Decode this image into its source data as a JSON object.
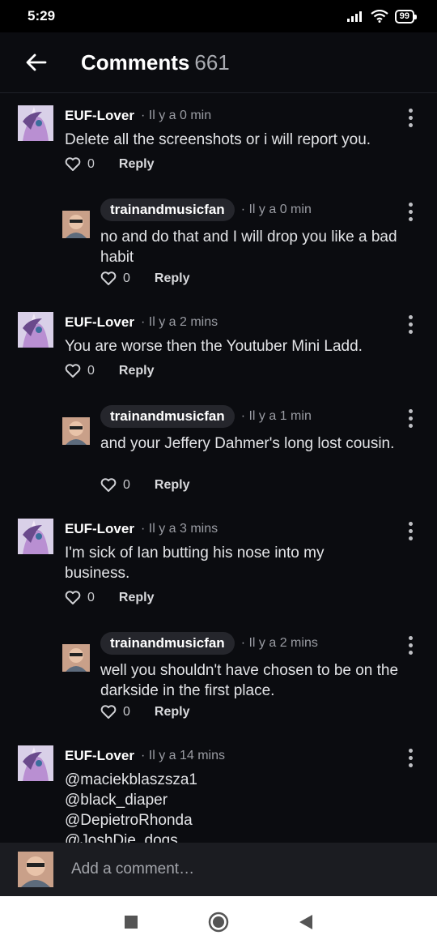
{
  "status": {
    "time": "5:29",
    "battery": "99"
  },
  "header": {
    "title": "Comments",
    "count": "661"
  },
  "comments": [
    {
      "author": "EUF-Lover",
      "meta": "· Il y a 0 min",
      "text": "Delete all the screenshots or i will report you.",
      "likes": "0",
      "reply_label": "Reply",
      "reply_level": false
    },
    {
      "author": "trainandmusicfan",
      "meta": "· Il y a 0 min",
      "text": "no and do that and I will drop you like a bad habit",
      "likes": "0",
      "reply_label": "Reply",
      "reply_level": true
    },
    {
      "author": "EUF-Lover",
      "meta": "· Il y a 2 mins",
      "text": "You are worse then the Youtuber Mini Ladd.",
      "likes": "0",
      "reply_label": "Reply",
      "reply_level": false
    },
    {
      "author": "trainandmusicfan",
      "meta": "· Il y a 1 min",
      "text": "and your Jeffery Dahmer's long lost cousin.",
      "likes": "0",
      "reply_label": "Reply",
      "reply_level": true
    },
    {
      "author": "EUF-Lover",
      "meta": "· Il y a 3 mins",
      "text": "I'm sick of Ian butting his nose into my business.",
      "likes": "0",
      "reply_label": "Reply",
      "reply_level": false
    },
    {
      "author": "trainandmusicfan",
      "meta": "· Il y a 2 mins",
      "text": "well you shouldn't have chosen to be on the darkside in the first place.",
      "likes": "0",
      "reply_label": "Reply",
      "reply_level": true
    },
    {
      "author": "EUF-Lover",
      "meta": "· Il y a 14 mins",
      "text_lines": [
        "@maciekblaszsza1",
        "@black_diaper",
        "@DepietroRhonda",
        "@JoshDie_dogs"
      ],
      "reply_level": false
    }
  ],
  "composer": {
    "placeholder": "Add a comment…"
  },
  "icons": {
    "back": "arrow-left-icon",
    "like": "heart-outline-icon",
    "more": "more-vertical-icon"
  }
}
